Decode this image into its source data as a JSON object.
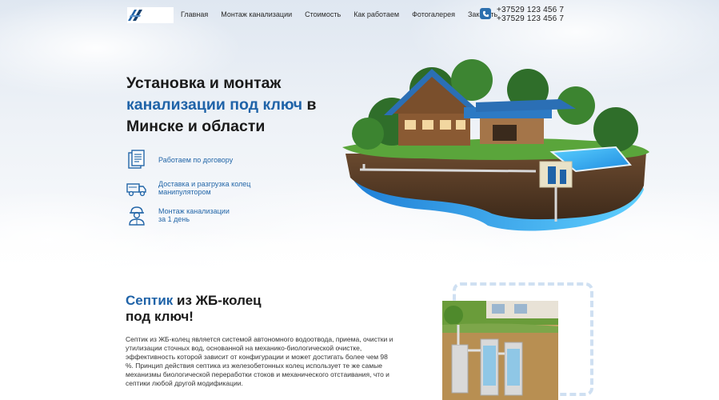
{
  "header": {
    "nav": [
      {
        "label": "Главная"
      },
      {
        "label": "Монтаж канализации"
      },
      {
        "label": "Стоимость"
      },
      {
        "label": "Как работаем"
      },
      {
        "label": "Фотогалерея"
      },
      {
        "label": "Заказать"
      }
    ],
    "phones": [
      "+37529 123 456 7",
      "+37529 123 456 7"
    ]
  },
  "hero": {
    "title_part1": "Установка и монтаж",
    "title_accent": "канализации под ключ",
    "title_part2": " в",
    "title_part3": "Минске и области",
    "features": [
      {
        "icon": "document-icon",
        "line1": "Работаем по договору",
        "line2": ""
      },
      {
        "icon": "truck-icon",
        "line1": "Доставка и разгрузка колец",
        "line2": "манипулятором"
      },
      {
        "icon": "worker-icon",
        "line1": "Монтаж канализации",
        "line2": "за 1 день"
      }
    ]
  },
  "septic": {
    "title_accent": "Септик",
    "title_rest1": " из ЖБ-колец",
    "title_rest2": "под ключ!",
    "text": "Септик из ЖБ-колец является системой автономного водоотвода, приема, очистки и утилизации сточных вод, основанной на механико-биологической очистке, эффективность которой зависит от конфигурации и может достигать более чем 98 %. Принцип действия септика из железобетонных колец использует те же самые механизмы биологической переработки стоков и механического отстаивания, что и септики любой другой модификации."
  },
  "colors": {
    "accent": "#1f63a8",
    "text": "#1a1a1a"
  }
}
